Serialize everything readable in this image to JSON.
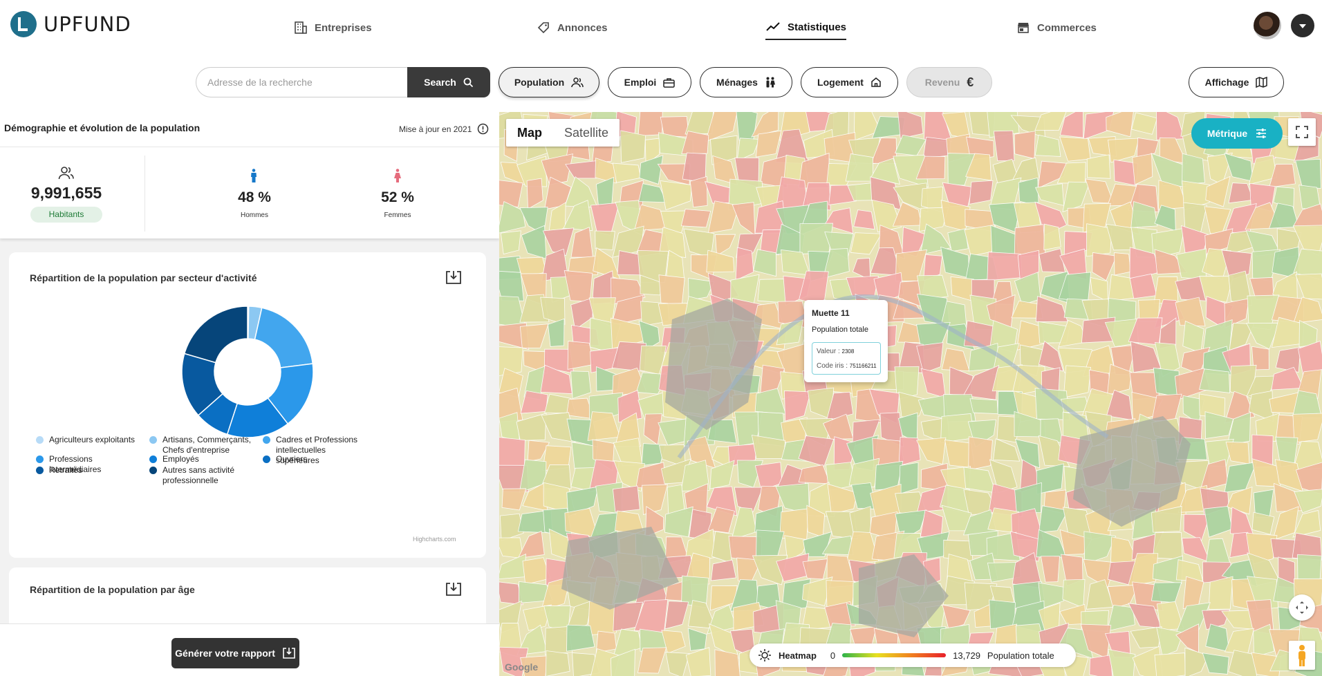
{
  "app": {
    "brand": "UPFUND"
  },
  "nav": {
    "tabs": [
      {
        "label": "Entreprises",
        "icon": "building-icon"
      },
      {
        "label": "Annonces",
        "icon": "tag-icon"
      },
      {
        "label": "Statistiques",
        "icon": "trend-icon",
        "active": true
      },
      {
        "label": "Commerces",
        "icon": "store-icon"
      }
    ]
  },
  "search": {
    "placeholder": "Adresse de la recherche",
    "button": "Search"
  },
  "filters": {
    "population": "Population",
    "emploi": "Emploi",
    "menages": "Ménages",
    "logement": "Logement",
    "revenu": "Revenu",
    "affichage": "Affichage"
  },
  "demo": {
    "title": "Démographie et évolution de la population",
    "updated": "Mise à jour en 2021",
    "habitants_value": "9,991,655",
    "habitants_label": "Habitants",
    "hommes_value": "48 %",
    "hommes_label": "Hommes",
    "femmes_value": "52 %",
    "femmes_label": "Femmes"
  },
  "sector_card": {
    "title": "Répartition de la population par secteur d'activité",
    "credit": "Highcharts.com"
  },
  "age_card": {
    "title": "Répartition de la population par âge"
  },
  "report": {
    "button": "Générer votre rapport"
  },
  "map": {
    "toggle_map": "Map",
    "toggle_satellite": "Satellite",
    "metric_button": "Métrique",
    "tooltip_title": "Muette 11",
    "tooltip_subtitle": "Population totale",
    "tooltip_value_label": "Valeur :",
    "tooltip_value": "2308",
    "tooltip_code_label": "Code iris :",
    "tooltip_code": "751166211",
    "heatmap_label": "Heatmap",
    "heat_min": "0",
    "heat_max": "13,729",
    "heat_metric": "Population totale",
    "google": "Google"
  },
  "chart_data": {
    "type": "pie",
    "title": "Répartition de la population par secteur d'activité",
    "categories": [
      "Agriculteurs exploitants",
      "Artisans, Commerçants, Chefs d'entreprise",
      "Cadres et Professions intellectuelles supérieures",
      "Professions intermédiaires",
      "Employés",
      "Ouvriers",
      "Retraités",
      "Autres sans activité professionnelle"
    ],
    "values": [
      0.3,
      3.2,
      19.5,
      16.5,
      15.5,
      8.5,
      16.0,
      20.5
    ],
    "colors": [
      "#b7dbf7",
      "#8cc8f2",
      "#42a6ee",
      "#2b98ea",
      "#0f7fd9",
      "#0a6fc3",
      "#08599f",
      "#06457a"
    ],
    "legend_placement": "bottom"
  }
}
